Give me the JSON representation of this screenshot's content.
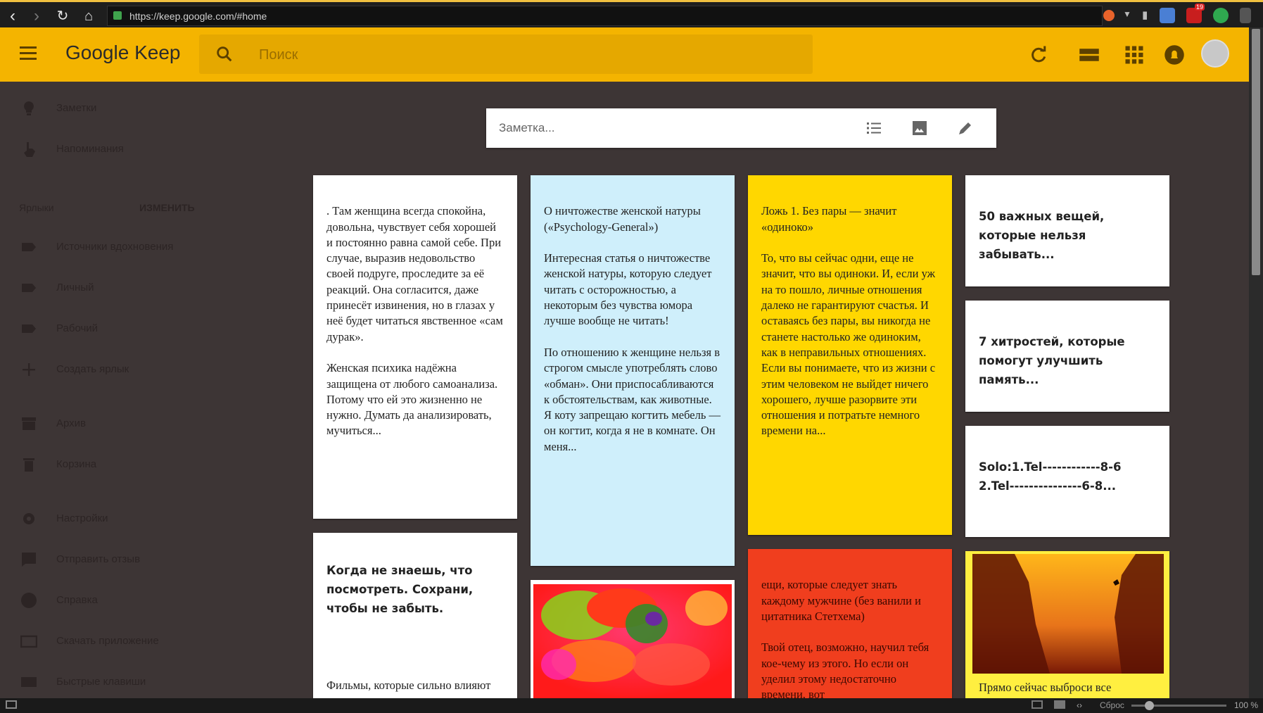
{
  "browser": {
    "url": "https://keep.google.com/#home",
    "badge_count": "19"
  },
  "header": {
    "logo_google": "Google",
    "logo_keep": "Keep",
    "search_placeholder": "Поиск"
  },
  "sidebar": {
    "items": [
      {
        "label": "Заметки",
        "icon": "bulb-icon"
      },
      {
        "label": "Напоминания",
        "icon": "reminder-hand-icon"
      }
    ],
    "labels_heading": "Ярлыки",
    "labels_edit": "ИЗМЕНИТЬ",
    "labels": [
      {
        "label": "Источники вдохновения",
        "icon": "label-icon"
      },
      {
        "label": "Личный",
        "icon": "label-icon"
      },
      {
        "label": "Рабочий",
        "icon": "label-icon"
      },
      {
        "label": "Создать ярлык",
        "icon": "plus-icon"
      }
    ],
    "bottom": [
      {
        "label": "Архив",
        "icon": "archive-icon"
      },
      {
        "label": "Корзина",
        "icon": "trash-icon"
      },
      {
        "label": "Настройки",
        "icon": "gear-icon"
      },
      {
        "label": "Отправить отзыв",
        "icon": "feedback-icon"
      },
      {
        "label": "Справка",
        "icon": "help-icon"
      },
      {
        "label": "Скачать приложение",
        "icon": "download-app-icon"
      },
      {
        "label": "Быстрые клавиши",
        "icon": "keyboard-icon"
      }
    ]
  },
  "take_note": {
    "placeholder": "Заметка..."
  },
  "notes": [
    {
      "color": "#ffffff",
      "text": ". Там женщина всегда спокойна, довольна, чувствует себя хорошей и постоянно равна самой себе. При случае, выразив недовольство своей подруге, проследите за её реакций. Она согласится, даже принесёт извинения, но в глазах у неё будет читаться явственное «сам дурак».\n\nЖенская психика надёжна защищена от любого самоанализа. Потому что ей это жизненно не нужно. Думать да анализировать, мучиться..."
    },
    {
      "color": "#ffffff",
      "title": "Когда не знаешь, что посмотреть. Сохрани, чтобы не забыть.",
      "text": "Фильмы, которые сильно влияют на мировоззрение и мироощущение:"
    },
    {
      "color": "#cfeffb",
      "text": "О ничтожестве женской натуры («Psychology-General»)\n\nИнтересная статья о ничтожестве женской натуры, которую следует читать с осторожностью, а некоторым без чувства юмора лучше вообще не читать!\n\nПо отношению к женщине нельзя в строгом смысле употреблять слово «обман». Они приспосабливаются к обстоятельствам, как животные. Я коту запрещаю когтить мебель — он когтит, когда я не в комнате. Он меня..."
    },
    {
      "color": "#ffd700",
      "text": "Ложь 1. Без пары — значит «одиноко»\n\nТо, что вы сейчас одни, еще не значит, что вы одиноки. И, если уж на то пошло, личные отношения далеко не гарантируют счастья. И оставаясь без пары, вы никогда не станете настолько же одиноким, как в неправильных отношениях. Если вы понимаете, что из жизни с этим человеком не выйдет ничего хорошего, лучше разорвите эти отношения и потратьте немного времени на..."
    },
    {
      "color": "#f03e1e",
      "text": "ещи, которые следует знать каждому мужчине (без ванили и цитатника Стетхема)\n\nТвой отец, возможно, научил тебя кое-чему из этого. Но если он уделил этому недостаточно времени, вот"
    },
    {
      "color": "#ffffff",
      "text": "50 важных вещей, которые нельзя забывать..."
    },
    {
      "color": "#ffffff",
      "text": "7 хитростей, которые помогут улучшить память..."
    },
    {
      "color": "#ffffff",
      "text": "Solo:1.Tel------------8-6\n     2.Tel---------------6-8..."
    },
    {
      "color": "#ffef40",
      "text": "Прямо сейчас выброси все"
    }
  ],
  "statusbar": {
    "reset": "Сброс",
    "zoom": "100 %"
  }
}
